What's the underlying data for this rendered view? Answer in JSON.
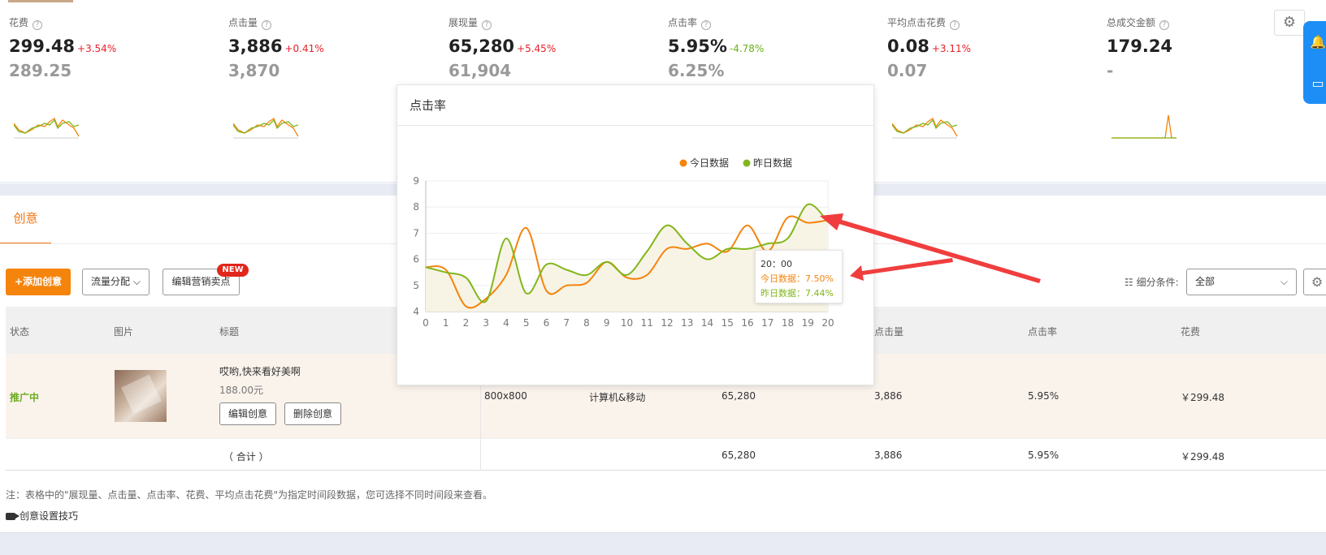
{
  "metrics": [
    {
      "label": "花费",
      "value": "299.48",
      "change": "+3.54%",
      "dir": "up",
      "yesterday": "289.25",
      "spark": "orange-green"
    },
    {
      "label": "点击量",
      "value": "3,886",
      "change": "+0.41%",
      "dir": "up",
      "yesterday": "3,870",
      "spark": "orange-green"
    },
    {
      "label": "展现量",
      "value": "65,280",
      "change": "+5.45%",
      "dir": "up",
      "yesterday": "61,904",
      "spark": "none"
    },
    {
      "label": "点击率",
      "value": "5.95%",
      "change": "-4.78%",
      "dir": "down",
      "yesterday": "6.25%",
      "spark": "none"
    },
    {
      "label": "平均点击花费",
      "value": "0.08",
      "change": "+3.11%",
      "dir": "up",
      "yesterday": "0.07",
      "spark": "orange-green"
    },
    {
      "label": "总成交金额",
      "value": "179.24",
      "change": "",
      "dir": "",
      "yesterday": "-",
      "spark": "spike"
    }
  ],
  "icons": {
    "help": "question-icon",
    "settings": "gear-icon",
    "bell": "bell-icon",
    "chat": "chat-icon",
    "list": "list-icon",
    "video": "camera-icon"
  },
  "tabs": {
    "active": "创意"
  },
  "toolbar": {
    "add_label": "+添加创意",
    "traffic_label": "流量分配",
    "edit_points_label": "编辑营销卖点",
    "new_badge": "NEW",
    "filter_label": "细分条件:",
    "filter_value": "全部"
  },
  "table": {
    "headers": {
      "status": "状态",
      "image": "图片",
      "title": "标题",
      "clicks": "点击量",
      "ctr": "点击率",
      "cost": "花费"
    },
    "row": {
      "status": "推广中",
      "title": "哎哟,快来看好美啊",
      "price": "188.00元",
      "edit_btn": "编辑创意",
      "delete_btn": "删除创意",
      "size": "800x800",
      "platform": "计算机&移动",
      "impressions": "65,280",
      "clicks": "3,886",
      "ctr": "5.95%",
      "cost": "￥299.48"
    },
    "sum": {
      "label": "（ 合计 ）",
      "impressions": "65,280",
      "clicks": "3,886",
      "ctr": "5.95%",
      "cost": "￥299.48"
    }
  },
  "note": "注：表格中的\"展现量、点击量、点击率、花费、平均点击花费\"为指定时间段数据，您可选择不同时间段来查看。",
  "tips_label": "创意设置技巧",
  "popup": {
    "title": "点击率",
    "tooltip": {
      "time": "20：00",
      "today": "今日数据：7.50%",
      "yesterday": "昨日数据：7.44%"
    }
  },
  "chart_data": {
    "type": "line",
    "title": "点击率",
    "x": [
      0,
      1,
      2,
      3,
      4,
      5,
      6,
      7,
      8,
      9,
      10,
      11,
      12,
      13,
      14,
      15,
      16,
      17,
      18,
      19,
      20
    ],
    "ylim": [
      4,
      9
    ],
    "yticks": [
      4,
      5,
      6,
      7,
      8,
      9
    ],
    "series": [
      {
        "name": "今日数据",
        "color": "#f5840d",
        "values": [
          5.7,
          5.6,
          4.2,
          4.5,
          5.4,
          7.2,
          4.8,
          5.0,
          5.1,
          5.9,
          5.3,
          5.4,
          6.4,
          6.4,
          6.6,
          6.3,
          7.3,
          6.3,
          7.6,
          7.4,
          7.5
        ]
      },
      {
        "name": "昨日数据",
        "color": "#82b61b",
        "values": [
          5.7,
          5.5,
          5.3,
          4.4,
          6.8,
          4.7,
          5.8,
          5.6,
          5.4,
          5.9,
          5.4,
          6.3,
          7.3,
          6.6,
          6.0,
          6.4,
          6.4,
          6.6,
          6.8,
          8.1,
          7.44
        ]
      }
    ]
  },
  "colors": {
    "accent": "#f5840d",
    "today": "#f5840d",
    "yesterday": "#82b61b",
    "up": "#e6212a",
    "down": "#6ab214",
    "arrow": "#f03e3e"
  }
}
